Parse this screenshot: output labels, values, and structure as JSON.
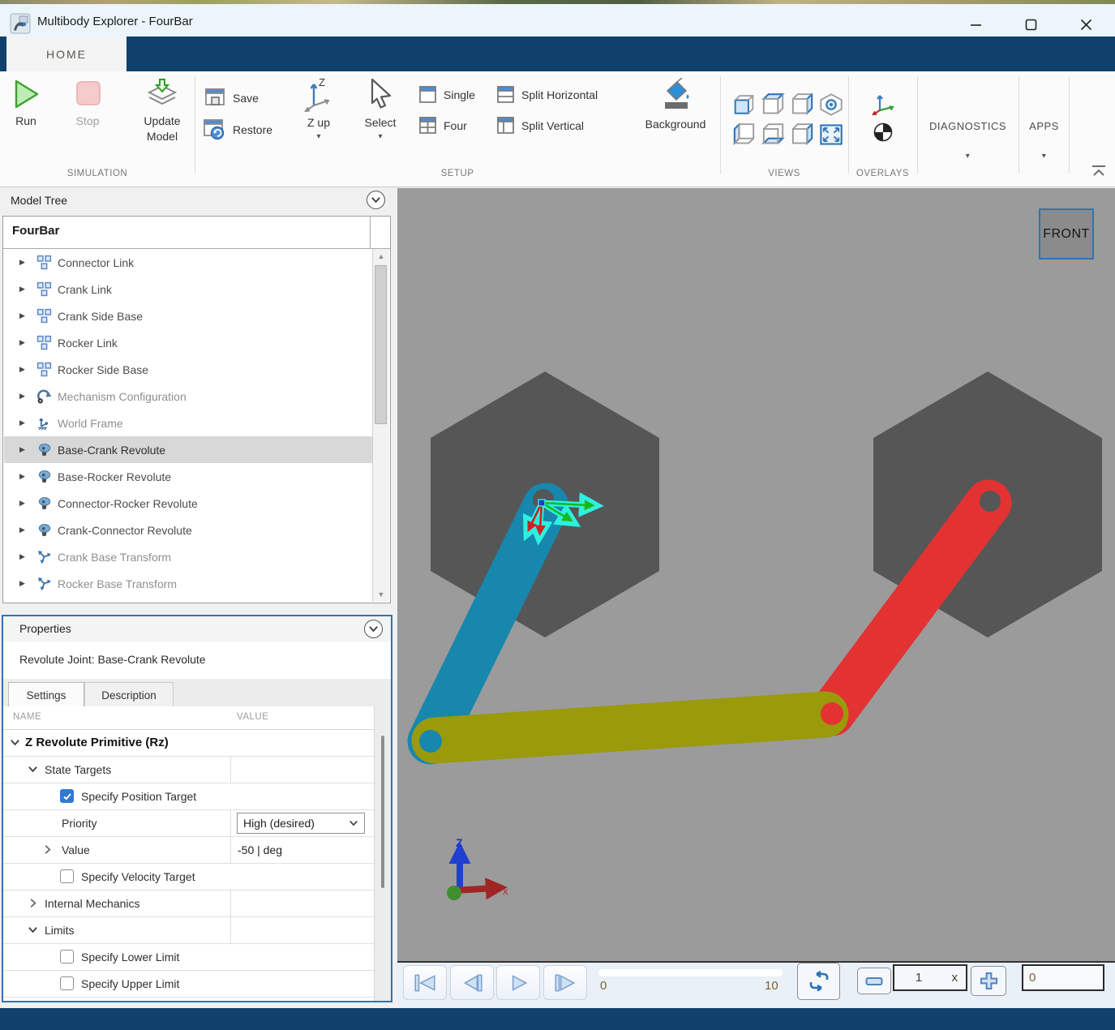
{
  "window": {
    "title": "Multibody Explorer - FourBar"
  },
  "ribbon": {
    "tab_home": "HOME",
    "simulation": {
      "run": "Run",
      "stop": "Stop",
      "update_model": "Update\nModel",
      "update_line1": "Update",
      "update_line2": "Model",
      "label": "SIMULATION"
    },
    "setup": {
      "save": "Save",
      "restore": "Restore",
      "zup": "Z up",
      "zup_axis_letter": "Z",
      "select": "Select",
      "single": "Single",
      "four": "Four",
      "split_h": "Split Horizontal",
      "split_v": "Split Vertical",
      "background": "Background",
      "label": "SETUP"
    },
    "views_label": "VIEWS",
    "overlays_label": "OVERLAYS",
    "diagnostics_label": "DIAGNOSTICS",
    "apps_label": "APPS"
  },
  "model_tree": {
    "panel_title": "Model Tree",
    "root": "FourBar",
    "items": [
      {
        "label": "Connector Link",
        "icon": "subsystem",
        "muted": false,
        "selected": false
      },
      {
        "label": "Crank Link",
        "icon": "subsystem",
        "muted": false,
        "selected": false
      },
      {
        "label": "Crank Side Base",
        "icon": "subsystem",
        "muted": false,
        "selected": false
      },
      {
        "label": "Rocker Link",
        "icon": "subsystem",
        "muted": false,
        "selected": false
      },
      {
        "label": "Rocker Side Base",
        "icon": "subsystem",
        "muted": false,
        "selected": false
      },
      {
        "label": "Mechanism Configuration",
        "icon": "mechanism-configuration",
        "muted": true,
        "selected": false
      },
      {
        "label": "World Frame",
        "icon": "world-frame",
        "muted": true,
        "selected": false
      },
      {
        "label": "Base-Crank Revolute",
        "icon": "revolute-joint",
        "muted": false,
        "selected": true
      },
      {
        "label": "Base-Rocker Revolute",
        "icon": "revolute-joint",
        "muted": false,
        "selected": false
      },
      {
        "label": "Connector-Rocker Revolute",
        "icon": "revolute-joint",
        "muted": false,
        "selected": false
      },
      {
        "label": "Crank-Connector Revolute",
        "icon": "revolute-joint",
        "muted": false,
        "selected": false
      },
      {
        "label": "Crank Base Transform",
        "icon": "rigid-transform",
        "muted": true,
        "selected": false
      },
      {
        "label": "Rocker Base Transform",
        "icon": "rigid-transform",
        "muted": true,
        "selected": false
      }
    ]
  },
  "properties": {
    "panel_title": "Properties",
    "subtitle": "Revolute Joint: Base-Crank Revolute",
    "tabs": {
      "settings": "Settings",
      "description": "Description"
    },
    "columns": {
      "name": "NAME",
      "value": "VALUE"
    },
    "rows": [
      {
        "name": "Z Revolute Primitive (Rz)",
        "type": "section",
        "expanded": true
      },
      {
        "name": "State Targets",
        "type": "group",
        "expanded": true
      },
      {
        "name": "Specify Position Target",
        "type": "checkbox",
        "checked": true
      },
      {
        "name": "Priority",
        "type": "dropdown",
        "value": "High (desired)"
      },
      {
        "name": "Value",
        "type": "value",
        "value": "-50 | deg",
        "expanded": false
      },
      {
        "name": "Specify Velocity Target",
        "type": "checkbox",
        "checked": false
      },
      {
        "name": "Internal Mechanics",
        "type": "group",
        "expanded": false
      },
      {
        "name": "Limits",
        "type": "group",
        "expanded": true
      },
      {
        "name": "Specify Lower Limit",
        "type": "checkbox",
        "checked": false
      },
      {
        "name": "Specify Upper Limit",
        "type": "checkbox",
        "checked": false
      }
    ]
  },
  "viewport": {
    "view_label": "FRONT",
    "triad": {
      "z_label": "Z",
      "x_label": "x"
    },
    "colors": {
      "background": "#9b9b9b",
      "hexagon": "#565656",
      "crank_blue": "#1787ae",
      "connector_olive": "#9a9a0b",
      "rocker_red": "#e23232",
      "highlight_cyan": "#2ef0e0"
    }
  },
  "playback": {
    "range_start": "0",
    "range_end": "10",
    "speed": "1",
    "speed_suffix": "x",
    "time": "0"
  },
  "glyphs": {
    "tree_expand": "▶",
    "caret_down": "▾",
    "scroll_up": "▲",
    "scroll_down": "▼"
  }
}
